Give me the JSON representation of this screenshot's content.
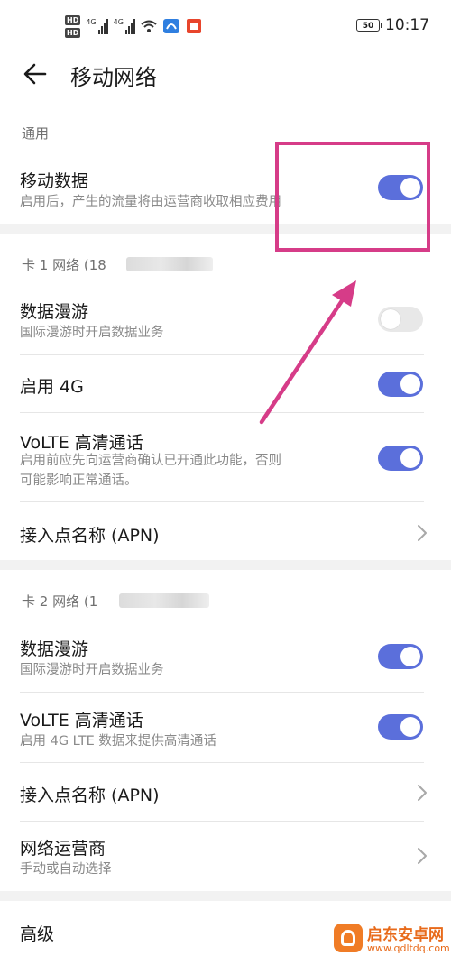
{
  "status_bar": {
    "hd1": "HD",
    "hd2": "HD",
    "net1": "4G",
    "net2": "4G",
    "battery": "50",
    "time": "10:17"
  },
  "header": {
    "title": "移动网络"
  },
  "general": {
    "section_label": "通用",
    "mobile_data": {
      "title": "移动数据",
      "subtitle": "启用后，产生的流量将由运营商收取相应费用",
      "enabled": true
    }
  },
  "sim1": {
    "section_label": "卡 1 网络 (18",
    "roaming": {
      "title": "数据漫游",
      "subtitle": "国际漫游时开启数据业务",
      "enabled": false
    },
    "enable_4g": {
      "title": "启用 4G",
      "enabled": true
    },
    "volte": {
      "title": "VoLTE 高清通话",
      "subtitle_line1": "启用前应先向运营商确认已开通此功能，否则",
      "subtitle_line2": "可能影响正常通话。",
      "enabled": true
    },
    "apn": {
      "title": "接入点名称 (APN)"
    }
  },
  "sim2": {
    "section_label": "卡 2 网络 (1",
    "roaming": {
      "title": "数据漫游",
      "subtitle": "国际漫游时开启数据业务",
      "enabled": true
    },
    "volte": {
      "title": "VoLTE 高清通话",
      "subtitle": "启用 4G LTE 数据来提供高清通话",
      "enabled": true
    },
    "apn": {
      "title": "接入点名称 (APN)"
    },
    "carrier": {
      "title": "网络运营商",
      "subtitle": "手动或自动选择"
    }
  },
  "advanced": {
    "title": "高级"
  },
  "watermark": {
    "name": "启东安卓网",
    "url": "www.qdltdq.com"
  },
  "colors": {
    "accent": "#5b6fdb",
    "annotation": "#d63c88"
  }
}
